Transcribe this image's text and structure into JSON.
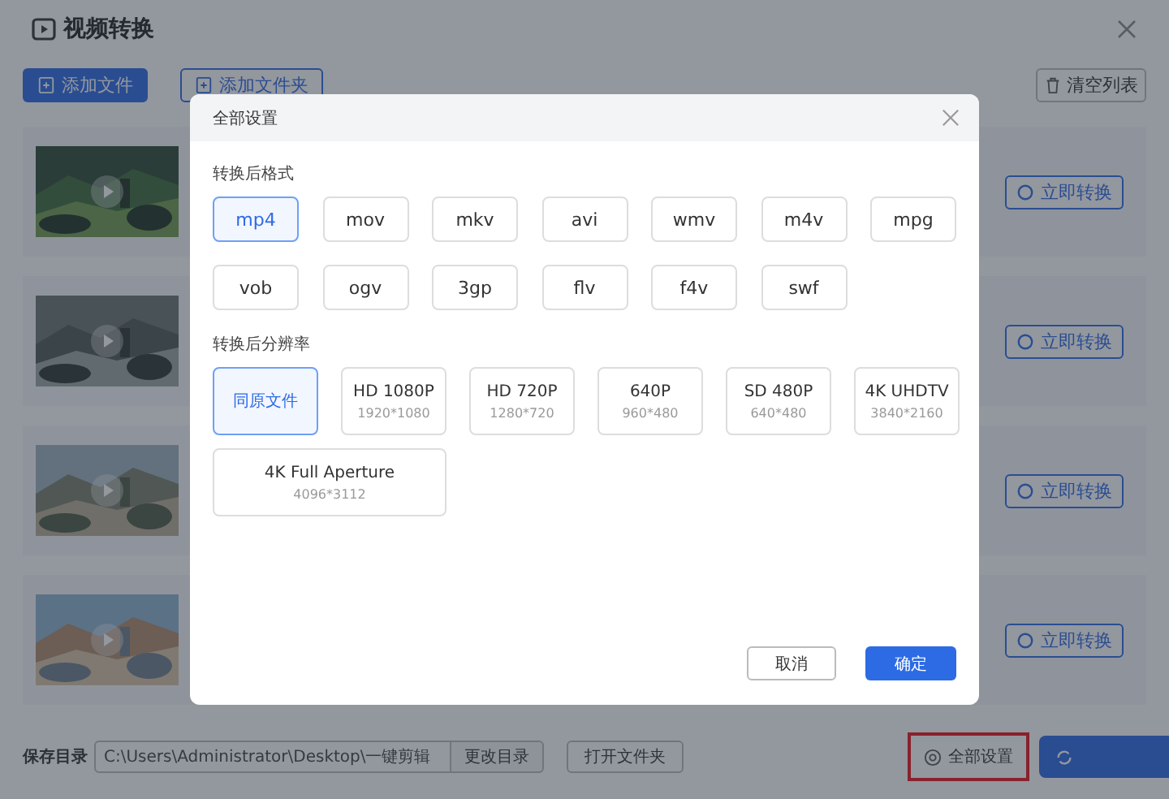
{
  "app": {
    "title": "视频转换",
    "toolbar": [
      {
        "label": "添加文件",
        "kind": "primary"
      },
      {
        "label": "添加文件夹",
        "kind": "outline"
      }
    ],
    "clear_button": "清空列表",
    "files": [
      {
        "kind": "picture",
        "action": "立即转换"
      },
      {
        "kind": "picture",
        "action": "立即转换"
      },
      {
        "kind": "picture",
        "action": "立即转换"
      },
      {
        "kind": "picture",
        "action": "立即转换"
      }
    ],
    "footer": {
      "save_label": "保存目录",
      "path": "C:\\Users\\Administrator\\Desktop\\一键剪辑",
      "change_button": "更改目录",
      "open_button": "打开文件夹",
      "settings_button": {
        "label": "全部设置",
        "highlighted": true
      }
    }
  },
  "dialog": {
    "title": "全部设置",
    "format_label": "转换后格式",
    "formats": [
      {
        "label": "mp4",
        "selected": true
      },
      {
        "label": "mov",
        "selected": false
      },
      {
        "label": "mkv",
        "selected": false
      },
      {
        "label": "avi",
        "selected": false
      },
      {
        "label": "wmv",
        "selected": false
      },
      {
        "label": "m4v",
        "selected": false
      },
      {
        "label": "mpg",
        "selected": false
      },
      {
        "label": "vob",
        "selected": false
      },
      {
        "label": "ogv",
        "selected": false
      },
      {
        "label": "3gp",
        "selected": false
      },
      {
        "label": "flv",
        "selected": false
      },
      {
        "label": "f4v",
        "selected": false
      },
      {
        "label": "swf",
        "selected": false
      }
    ],
    "resolution_label": "转换后分辨率",
    "resolutions": [
      {
        "label": "同原文件",
        "selected": true
      },
      {
        "label": "HD 1080P",
        "size": "1920*1080",
        "selected": false
      },
      {
        "label": "HD 720P",
        "size": "1280*720",
        "selected": false
      },
      {
        "label": "640P",
        "size": "960*480",
        "selected": false
      },
      {
        "label": "SD 480P",
        "size": "640*480",
        "selected": false
      },
      {
        "label": "4K UHDTV",
        "size": "3840*2160",
        "selected": false
      },
      {
        "label": "4K Full Aperture",
        "size": "4096*3112",
        "selected": false,
        "wide": true
      }
    ],
    "cancel": "取消",
    "confirm": "确定"
  }
}
